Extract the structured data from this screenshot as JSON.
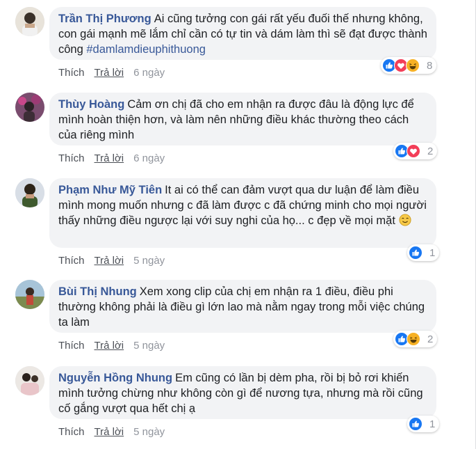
{
  "comments": [
    {
      "author": "Trần Thị Phương",
      "text": "Ai cũng tưởng con gái rất yếu đuối thế nhưng không, con gái mạnh mẽ lắm chỉ cần có tự tin và dám làm thì sẽ đạt được thành công ",
      "hashtag": "#damlamdieuphithuong",
      "like_label": "Thích",
      "reply_label": "Trả lời",
      "time": "6 ngày",
      "reactions": [
        "like-icon",
        "love-icon",
        "haha-icon"
      ],
      "reaction_count": "8"
    },
    {
      "author": "Thùy Hoàng",
      "text": "Cảm ơn chị đã cho em nhận ra được đâu là động lực để mình hoàn thiện hơn, và làm nên những điều khác thường theo cách của riêng mình",
      "like_label": "Thích",
      "reply_label": "Trả lời",
      "time": "6 ngày",
      "reactions": [
        "like-icon",
        "love-icon"
      ],
      "reaction_count": "2"
    },
    {
      "author": "Phạm Như Mỹ Tiên",
      "text": "It ai có thể can đảm vượt qua dư luận để làm điều mình mong muốn nhưng c đã làm được c đã chứng minh cho mọi người thấy những điều ngược lại với suy nghi của họ... c đẹp về mọi mặt",
      "like_label": "Thích",
      "reply_label": "Trả lời",
      "time": "5 ngày",
      "reactions": [
        "like-icon"
      ],
      "reaction_count": "1"
    },
    {
      "author": "Bùi Thị Nhung",
      "text": "Xem xong clip của chị em nhận ra 1 điều, điều phi thường không phải là điều gì lớn lao mà nằm ngay trong mỗi việc chúng ta làm",
      "like_label": "Thích",
      "reply_label": "Trả lời",
      "time": "5 ngày",
      "reactions": [
        "like-icon",
        "haha-icon"
      ],
      "reaction_count": "2"
    },
    {
      "author": "Nguyễn Hồng Nhung",
      "text": "Em cũng có lần bị dèm pha, rồi bị bỏ rơi khiến mình tưởng chừng như không còn gì để nương tựa, nhưng mà rồi cũng cố gắng vượt qua hết chị ạ",
      "like_label": "Thích",
      "reply_label": "Trả lời",
      "time": "5 ngày",
      "reactions": [
        "like-icon"
      ],
      "reaction_count": "1"
    }
  ],
  "colors": {
    "author_link": "#385898",
    "bubble_bg": "#f2f3f5",
    "like_blue": "#1877f2",
    "love_red": "#f33e58",
    "haha_yellow": "#f7b125"
  }
}
